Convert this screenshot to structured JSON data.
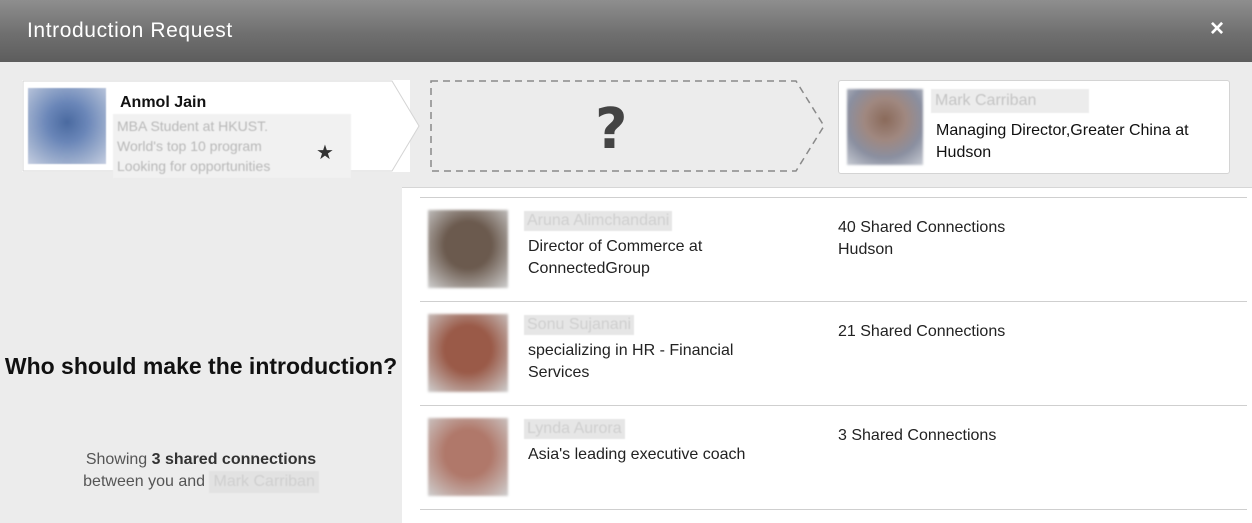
{
  "dialog": {
    "title": "Introduction Request",
    "close_label": "×"
  },
  "from": {
    "name": "Anmol Jain",
    "headline_lines": [
      "MBA Student at HKUST.",
      "World's top 10 program",
      "Looking for opportunities"
    ],
    "star": "★"
  },
  "middle": {
    "placeholder": "?"
  },
  "to": {
    "name": "Mark Carriban",
    "title": "Managing Director,Greater China at Hudson"
  },
  "panel": {
    "heading": "Who should make the introduction?",
    "sub_prefix": "Showing",
    "sub_count": "3 shared connections",
    "sub_suffix": "between you and",
    "sub_name": "Mark Carriban"
  },
  "connections": [
    {
      "name": "Aruna Alimchandani",
      "headline": "Director of Commerce at ConnectedGroup",
      "shared": "40 Shared Connections",
      "company": "Hudson",
      "photo_color": "#6b5a4e"
    },
    {
      "name": "Sonu Sujanani",
      "headline": "specializing in HR - Financial Services",
      "shared": "21 Shared Connections",
      "company": "",
      "photo_color": "#9a5a48"
    },
    {
      "name": "Lynda Aurora",
      "headline": "Asia's leading executive coach",
      "shared": "3 Shared Connections",
      "company": "",
      "photo_color": "#b0786a"
    }
  ]
}
